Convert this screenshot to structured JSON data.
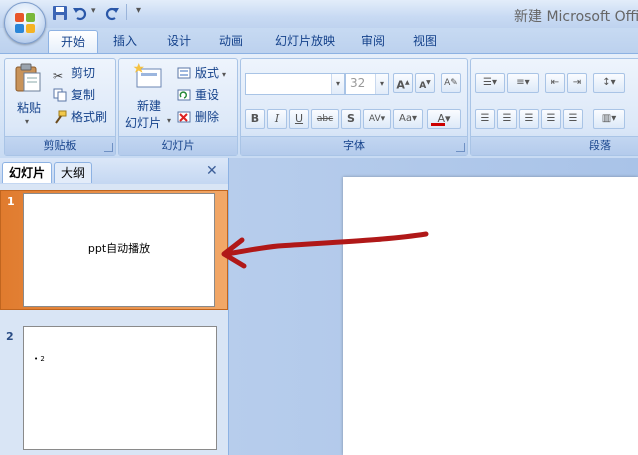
{
  "window": {
    "title": "新建 Microsoft Offic"
  },
  "quick_access": {
    "icons": [
      "save-icon",
      "undo-icon",
      "redo-icon",
      "customize-icon"
    ]
  },
  "tabs": [
    {
      "label": "开始",
      "active": true
    },
    {
      "label": "插入"
    },
    {
      "label": "设计"
    },
    {
      "label": "动画"
    },
    {
      "label": "幻灯片放映"
    },
    {
      "label": "审阅"
    },
    {
      "label": "视图"
    }
  ],
  "ribbon": {
    "clipboard": {
      "label": "剪贴板",
      "paste": "粘贴",
      "cut": "剪切",
      "copy": "复制",
      "format_painter": "格式刷"
    },
    "slides": {
      "label": "幻灯片",
      "new_slide_line1": "新建",
      "new_slide_line2": "幻灯片",
      "layout": "版式",
      "reset": "重设",
      "delete": "删除"
    },
    "font": {
      "label": "字体",
      "font_name": "",
      "font_size": "32"
    },
    "paragraph": {
      "label": "段落"
    }
  },
  "left_pane": {
    "tab_slides": "幻灯片",
    "tab_outline": "大纲",
    "slides": [
      {
        "number": "1",
        "text": "ppt自动播放",
        "selected": true
      },
      {
        "number": "2",
        "text": "• 2",
        "selected": false
      }
    ]
  },
  "accent_colors": {
    "selected_slide": "#e07b2e",
    "annotation_arrow": "#b01818"
  }
}
